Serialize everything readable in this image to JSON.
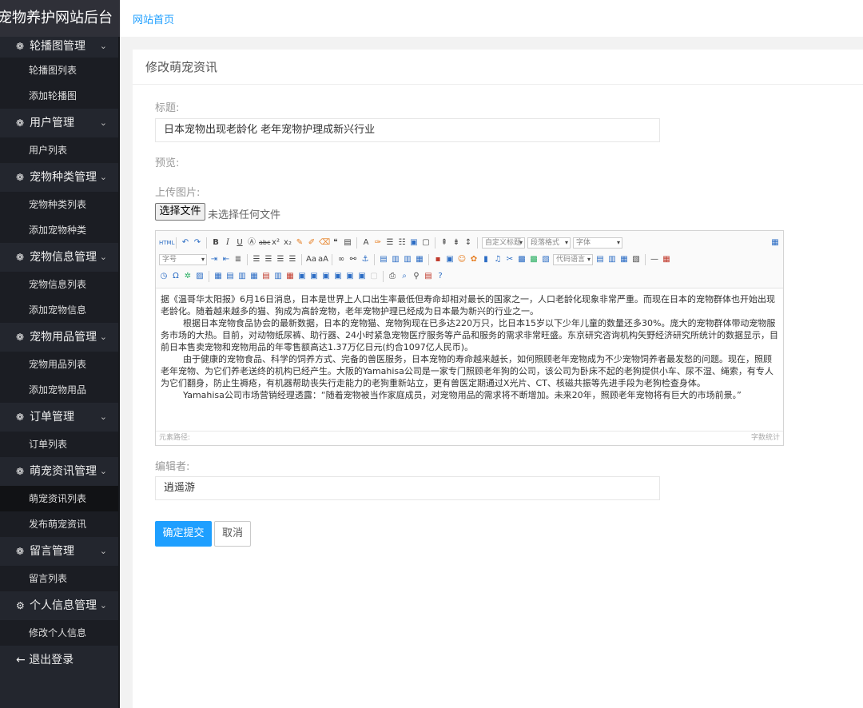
{
  "brand": "宠物养护网站后台",
  "topbar": {
    "home_link": "网站首页"
  },
  "sidebar": {
    "groups": [
      {
        "label": "轮播图管理",
        "icon": "gear-icon",
        "items": [
          "轮播图列表",
          "添加轮播图"
        ]
      },
      {
        "label": "用户管理",
        "icon": "gear-icon",
        "items": [
          "用户列表"
        ]
      },
      {
        "label": "宠物种类管理",
        "icon": "gear-icon",
        "items": [
          "宠物种类列表",
          "添加宠物种类"
        ]
      },
      {
        "label": "宠物信息管理",
        "icon": "gear-icon",
        "items": [
          "宠物信息列表",
          "添加宠物信息"
        ]
      },
      {
        "label": "宠物用品管理",
        "icon": "gear-icon",
        "items": [
          "宠物用品列表",
          "添加宠物用品"
        ]
      },
      {
        "label": "订单管理",
        "icon": "gear-icon",
        "items": [
          "订单列表"
        ]
      },
      {
        "label": "萌宠资讯管理",
        "icon": "gear-icon",
        "items": [
          "萌宠资讯列表",
          "发布萌宠资讯"
        ]
      },
      {
        "label": "留言管理",
        "icon": "gear-icon",
        "items": [
          "留言列表"
        ]
      },
      {
        "label": "个人信息管理",
        "icon": "settings-icon",
        "items": [
          "修改个人信息"
        ]
      }
    ],
    "active_item": "萌宠资讯列表",
    "logout": "退出登录"
  },
  "panel": {
    "title": "修改萌宠资讯",
    "title_label": "标题:",
    "title_value": "日本宠物出现老龄化 老年宠物护理成新兴行业",
    "preview_label": "预览:",
    "upload_label": "上传图片:",
    "file_button": "选择文件",
    "file_status": "未选择任何文件",
    "editor": {
      "selects": {
        "custom_title": "自定义标题",
        "paragraph": "段落格式",
        "font": "字体",
        "size": "字号",
        "code_lang": "代码语言"
      },
      "paragraphs": [
        "据《温哥华太阳报》6月16日消息，日本是世界上人口出生率最低但寿命却相对最长的国家之一，人口老龄化现象非常严重。而现在日本的宠物群体也开始出现老龄化。随着越来越多的猫、狗成为高龄宠物，老年宠物护理已经成为日本最为新兴的行业之一。",
        "根据日本宠物食品协会的最新数据，日本的宠物猫、宠物狗现在已多达220万只，比日本15岁以下少年儿童的数量还多30%。庞大的宠物群体带动宠物服务市场的大热。目前，对动物纸尿裤、助行器、24小时紧急宠物医疗服务等产品和服务的需求非常旺盛。东京研究咨询机构矢野经济研究所统计的数据显示，目前日本售卖宠物和宠物用品的年零售额高达1.37万亿日元(约合1097亿人民币)。",
        "由于健康的宠物食品、科学的饲养方式、完备的兽医服务，日本宠物的寿命越来越长，如何照顾老年宠物成为不少宠物饲养者最发愁的问题。现在，照顾老年宠物、为它们养老送终的机构已经产生。大阪的Yamahisa公司是一家专门照顾老年狗的公司，该公司为卧床不起的老狗提供小车、尿不湿、绳索，有专人为它们翻身，防止生褥疮，有机器帮助丧失行走能力的老狗重新站立，更有兽医定期通过X光片、CT、核磁共振等先进手段为老狗检查身体。",
        "Yamahisa公司市场营销经理透露：“随着宠物被当作家庭成员，对宠物用品的需求将不断增加。未来20年，照顾老年宠物将有巨大的市场前景。”"
      ],
      "status_left": "元素路径:",
      "status_right": "字数统计"
    },
    "editor_label": "编辑者:",
    "editor_value": "逍遥游",
    "submit": "确定提交",
    "cancel": "取消"
  }
}
